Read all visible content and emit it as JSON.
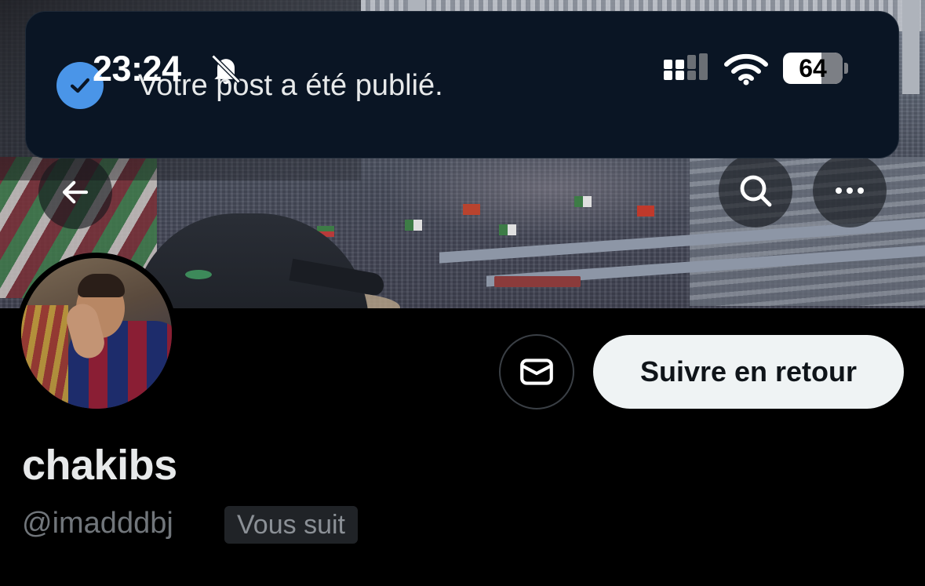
{
  "status_bar": {
    "time": "23:24",
    "battery_level": "64",
    "icons": [
      "bell-slash-icon",
      "cellular-signal-icon",
      "wifi-icon",
      "battery-icon"
    ]
  },
  "notification": {
    "icon": "check-circle-icon",
    "message": "Votre post a été publié."
  },
  "header": {
    "back_icon": "arrow-left-icon",
    "search_icon": "search-icon",
    "more_icon": "more-horizontal-icon"
  },
  "profile": {
    "display_name": "chakibs",
    "handle": "@imadddbj",
    "follows_you_badge": "Vous suit",
    "message_icon": "envelope-icon",
    "follow_button_label": "Suivre en retour"
  },
  "colors": {
    "background": "#000000",
    "toast_background": "#0a1524",
    "check_blue": "#4a95e8",
    "button_light": "#eff3f4",
    "muted_text": "#71767b"
  }
}
